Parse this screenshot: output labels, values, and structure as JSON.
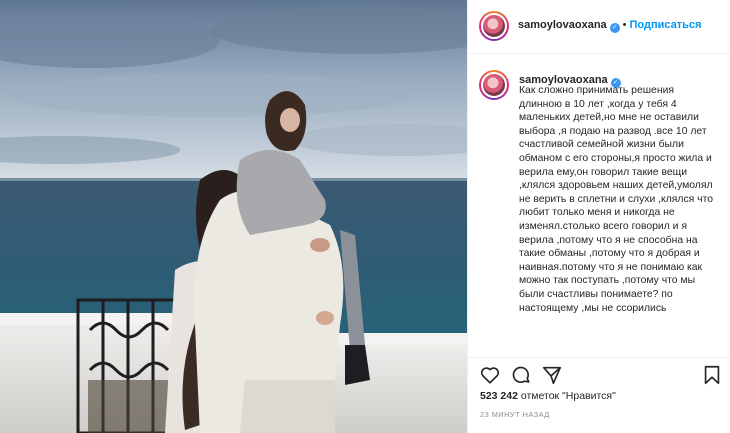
{
  "post": {
    "username": "samoylovaoxana",
    "separator": "•",
    "follow_label": "Подписаться",
    "caption": "Как сложно принимать решения длинною в 10 лет ,когда у тебя 4 маленьких детей,но мне не оставили выбора ,я подаю на развод .все 10 лет счастливой семейной жизни были обманом с его стороны,я просто жила и верила ему,он говорил такие вещи ,клялся здоровьем наших детей,умолял не верить в сплетни и слухи ,клялся что любит только меня и никогда не изменял.столько всего говорил и я верила ,потому что я не способна на такие обманы ,потому что я добрая и наивная.потому что я не понимаю как можно так поступать ,потому что мы были счастливы понимаете? по настоящему ,мы не ссорились",
    "likes_count": "523 242",
    "likes_suffix": "отметок \"Нравится\"",
    "time_ago": "23 МИНУТ НАЗАД"
  },
  "icons": {
    "verified": "verified-badge-icon",
    "like": "heart-icon",
    "comment": "comment-icon",
    "share": "paper-plane-icon",
    "save": "bookmark-icon"
  },
  "colors": {
    "accent": "#0095f6",
    "verified": "#3897f0",
    "text": "#262626",
    "muted": "#8e8e8e",
    "divider": "#efefef"
  }
}
